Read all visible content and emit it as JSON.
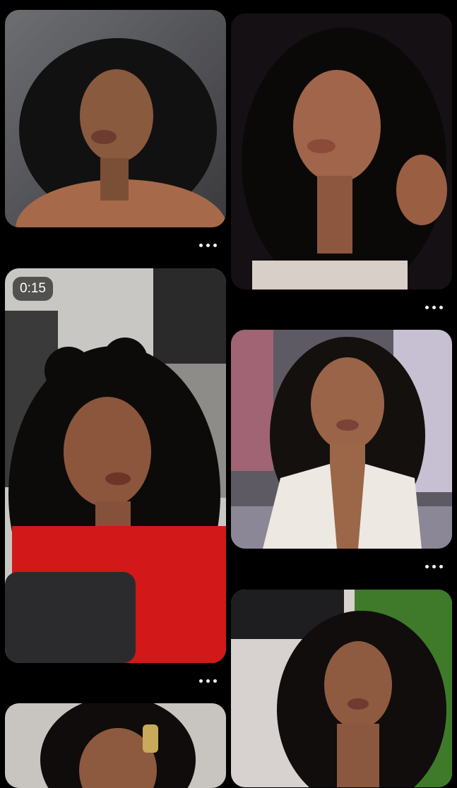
{
  "feed": {
    "pins": [
      {
        "id": "pin-1",
        "alt": "",
        "has_video": false
      },
      {
        "id": "pin-2",
        "alt": "",
        "has_video": false
      },
      {
        "id": "pin-3",
        "alt": "",
        "has_video": true,
        "duration": "0:15"
      },
      {
        "id": "pin-4",
        "alt": "",
        "has_video": false
      },
      {
        "id": "pin-5",
        "alt": "",
        "has_video": false
      },
      {
        "id": "pin-6",
        "alt": "",
        "has_video": false
      }
    ],
    "more_icon": "more-horizontal-icon"
  },
  "colors": {
    "background": "#000000",
    "dots": "#f2f2f2",
    "badge_bg": "#3c3c3c",
    "badge_text": "#ffffff"
  }
}
